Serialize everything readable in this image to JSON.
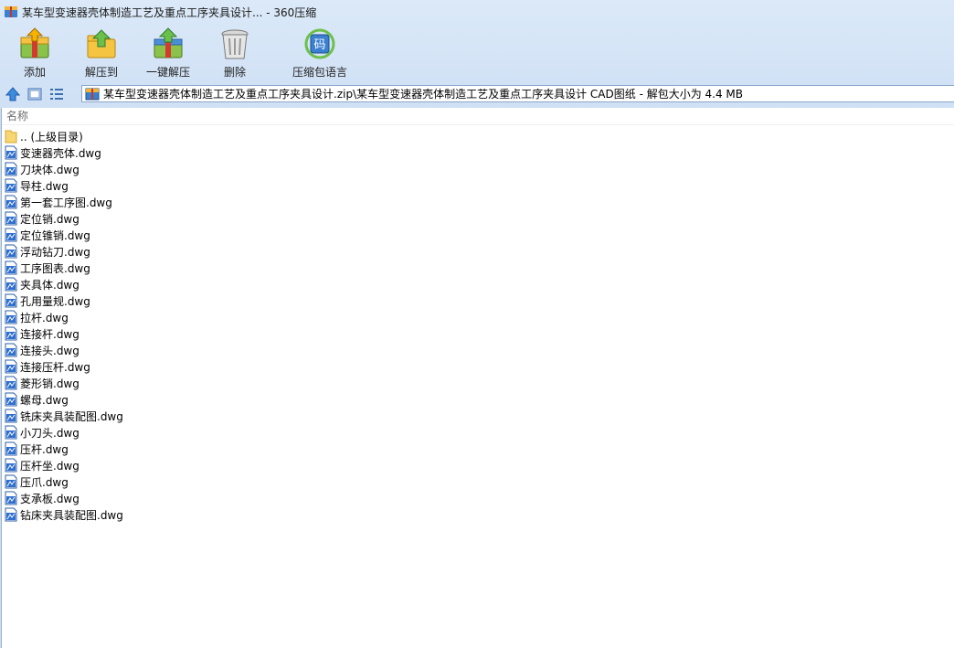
{
  "window": {
    "title": "某车型变速器壳体制造工艺及重点工序夹具设计... - 360压缩"
  },
  "toolbar": {
    "items": [
      {
        "label": "添加",
        "icon": "add-archive-icon"
      },
      {
        "label": "解压到",
        "icon": "extract-to-icon"
      },
      {
        "label": "一键解压",
        "icon": "one-click-extract-icon"
      },
      {
        "label": "删除",
        "icon": "delete-trash-icon"
      },
      {
        "label": "压缩包语言",
        "icon": "archive-language-icon"
      }
    ]
  },
  "address": {
    "path": "某车型变速器壳体制造工艺及重点工序夹具设计.zip\\某车型变速器壳体制造工艺及重点工序夹具设计 CAD图纸 - 解包大小为 4.4 MB"
  },
  "list": {
    "column_name": "名称",
    "parent": ".. (上级目录)",
    "files": [
      "变速器壳体.dwg",
      "刀块体.dwg",
      "导柱.dwg",
      "第一套工序图.dwg",
      "定位销.dwg",
      "定位锥销.dwg",
      "浮动钻刀.dwg",
      "工序图表.dwg",
      "夹具体.dwg",
      "孔用量规.dwg",
      "拉杆.dwg",
      "连接杆.dwg",
      "连接头.dwg",
      "连接压杆.dwg",
      "菱形销.dwg",
      "螺母.dwg",
      "铣床夹具装配图.dwg",
      "小刀头.dwg",
      "压杆.dwg",
      "压杆坐.dwg",
      "压爪.dwg",
      "支承板.dwg",
      "钻床夹具装配图.dwg"
    ]
  }
}
